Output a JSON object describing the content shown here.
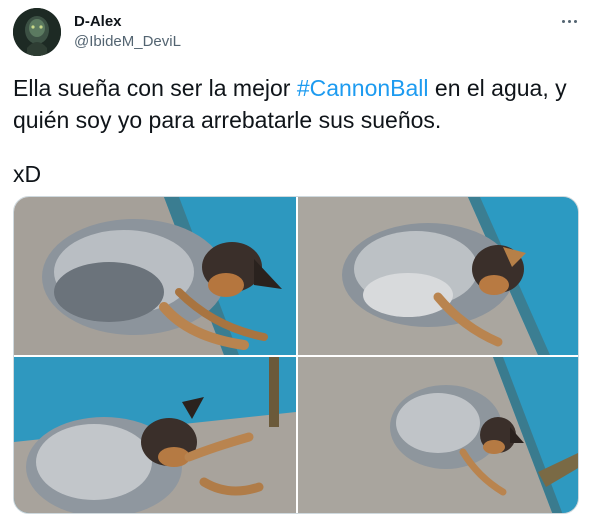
{
  "tweet": {
    "author": {
      "display_name": "D-Alex",
      "handle": "@IbideM_DeviL"
    },
    "text_before": "Ella sueña con ser la mejor ",
    "hashtag": "#CannonBall",
    "text_after": " en el agua, y",
    "text_line2": "quién soy yo para arrebatarle sus sueños.",
    "text_extra": "xD",
    "media_count": 4
  },
  "icons": {
    "more": "more-horizontal-icon"
  },
  "colors": {
    "link": "#1d9bf0",
    "secondary_text": "#536471",
    "border": "#cfd9de",
    "wall_blue": "#2f9bc0",
    "floor_gray": "#a9a49c"
  }
}
